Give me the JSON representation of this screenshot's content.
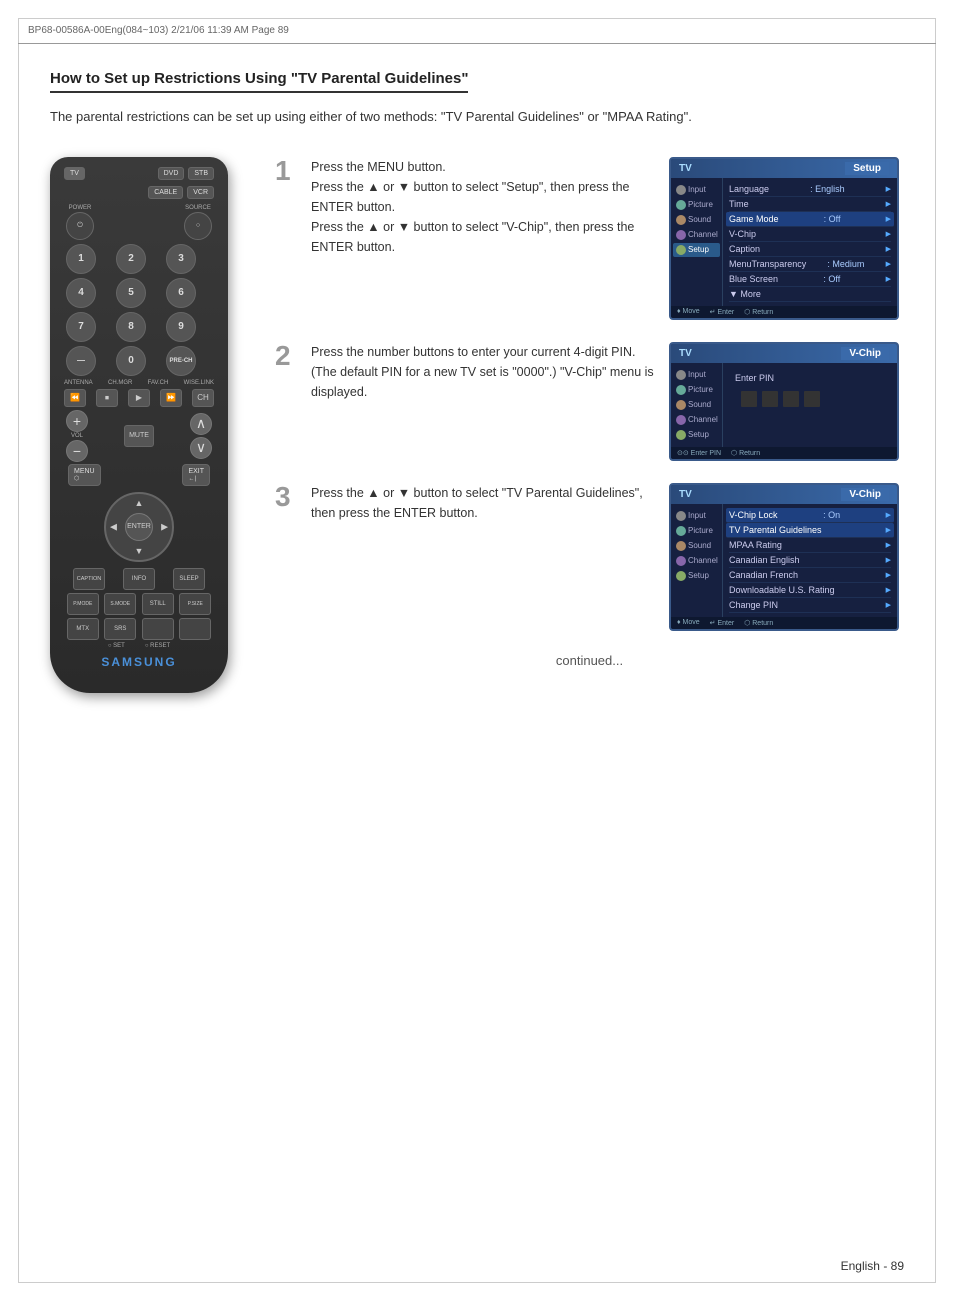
{
  "header": {
    "text": "BP68-00586A-00Eng(084~103)   2/21/06   11:39 AM   Page 89"
  },
  "page": {
    "title": "How to Set up Restrictions Using \"TV Parental Guidelines\"",
    "intro": "The parental restrictions can be set up using either of two methods: \"TV Parental Guidelines\" or \"MPAA Rating\".",
    "continued": "continued...",
    "footer": "English - 89"
  },
  "steps": [
    {
      "number": "1",
      "text": "Press the MENU button.\nPress the ▲ or ▼ button to select \"Setup\", then press the ENTER button.\nPress the ▲ or ▼ button to select \"V-Chip\", then press the ENTER button."
    },
    {
      "number": "2",
      "text": "Press the number buttons to enter your current 4-digit PIN. (The default PIN for a new TV set is \"0000\".) \"V-Chip\" menu is displayed."
    },
    {
      "number": "3",
      "text": "Press the ▲ or ▼ button to select \"TV Parental Guidelines\", then press the ENTER button."
    }
  ],
  "screen1": {
    "tv_label": "TV",
    "title": "Setup",
    "sidebar_items": [
      "Input",
      "Picture",
      "Sound",
      "Channel",
      "Setup"
    ],
    "active_sidebar": "Setup",
    "menu_items": [
      {
        "name": "Language",
        "value": ": English",
        "arrow": true
      },
      {
        "name": "Time",
        "value": "",
        "arrow": true
      },
      {
        "name": "Game Mode",
        "value": ": Off",
        "arrow": true
      },
      {
        "name": "V-Chip",
        "value": "",
        "arrow": true
      },
      {
        "name": "Caption",
        "value": "",
        "arrow": true
      },
      {
        "name": "MenuTransparency",
        "value": ": Medium",
        "arrow": true
      },
      {
        "name": "Blue Screen",
        "value": ": Off",
        "arrow": true
      },
      {
        "name": "▼ More",
        "value": "",
        "arrow": false
      }
    ],
    "footer": "♦ Move   ↵ Enter   ⬡ Return"
  },
  "screen2": {
    "tv_label": "TV",
    "title": "V-Chip",
    "sidebar_items": [
      "Input",
      "Picture",
      "Sound",
      "Channel",
      "Setup"
    ],
    "active_sidebar": "Input",
    "enter_pin_label": "Enter PIN",
    "footer": "⊙⊙ Enter PIN   ⬡ Return"
  },
  "screen3": {
    "tv_label": "TV",
    "title": "V-Chip",
    "sidebar_items": [
      "Input",
      "Picture",
      "Sound",
      "Channel",
      "Setup"
    ],
    "active_sidebar": "Input",
    "menu_items": [
      {
        "name": "V-Chip Lock",
        "value": ": On",
        "arrow": true,
        "highlighted": true
      },
      {
        "name": "TV Parental Guidelines",
        "value": "",
        "arrow": true,
        "highlighted": true
      },
      {
        "name": "MPAA Rating",
        "value": "",
        "arrow": true
      },
      {
        "name": "Canadian English",
        "value": "",
        "arrow": true
      },
      {
        "name": "Canadian French",
        "value": "",
        "arrow": true
      },
      {
        "name": "Downloadable U.S. Rating",
        "value": "",
        "arrow": true
      },
      {
        "name": "Change PIN",
        "value": "",
        "arrow": true
      }
    ],
    "footer": "♦ Move   ↵ Enter   ⬡ Return"
  },
  "remote": {
    "tabs": [
      "TV",
      "DVD",
      "STB",
      "CABLE",
      "VCR"
    ],
    "labels": {
      "power": "POWER",
      "source": "SOURCE",
      "antenna": "ANTENNA",
      "ch_mgr": "CH.MGR",
      "fav_ch": "FAV.CH",
      "wise_link": "WISE.LINK",
      "vol": "VOL",
      "mute": "MUTE",
      "menu": "MENU",
      "exit": "EXIT",
      "enter": "ENTER",
      "caption": "CAPTION",
      "info": "INFO",
      "sleep": "SLEEP",
      "p_mode": "P.MODE",
      "s_mode": "S.MODE",
      "still": "STILL",
      "p_size": "P.SIZE",
      "mtx": "MTX",
      "srs": "SRS",
      "set": "SET",
      "reset": "RESET",
      "samsung": "SAMSUNG"
    }
  }
}
